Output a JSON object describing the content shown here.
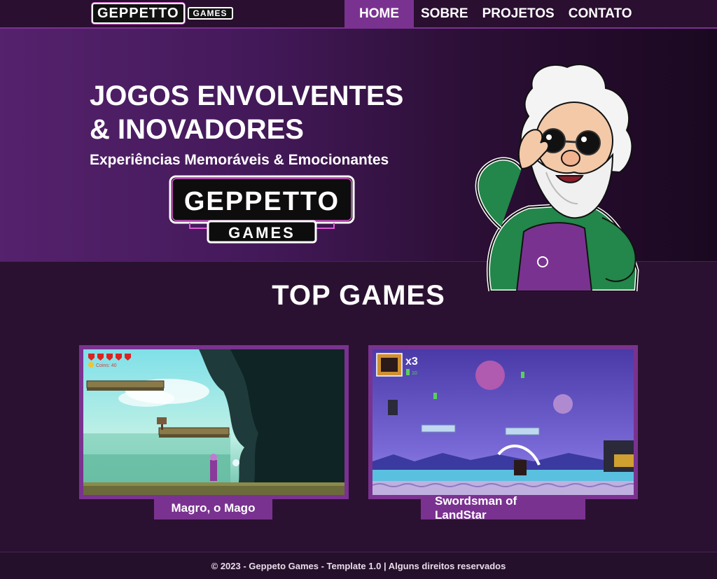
{
  "nav": {
    "logo_main": "GEPPETTO",
    "logo_sub": "GAMES",
    "links": [
      {
        "label": "HOME",
        "active": true
      },
      {
        "label": "SOBRE",
        "active": false
      },
      {
        "label": "PROJETOS",
        "active": false
      },
      {
        "label": "CONTATO",
        "active": false
      }
    ]
  },
  "hero": {
    "title_line1": "JOGOS ENVOLVENTES",
    "title_line2": "& INOVADORES",
    "subtitle": "Experiências Memoráveis & Emocionantes",
    "logo_main": "GEPPETTO",
    "logo_sub": "GAMES"
  },
  "games_section": {
    "title": "TOP GAMES",
    "games": [
      {
        "title": "Magro, o Mago",
        "hud_coins": "Coins: 40"
      },
      {
        "title": "Swordsman of LandStar",
        "hud_lives": "x3",
        "hud_gems": "10"
      }
    ]
  },
  "footer": {
    "text": "© 2023 - Geppeto Games - Template 1.0 | Alguns direitos reservados"
  },
  "colors": {
    "accent": "#7a3290",
    "background": "#2b1131",
    "nav_bg": "#2a0f30"
  }
}
